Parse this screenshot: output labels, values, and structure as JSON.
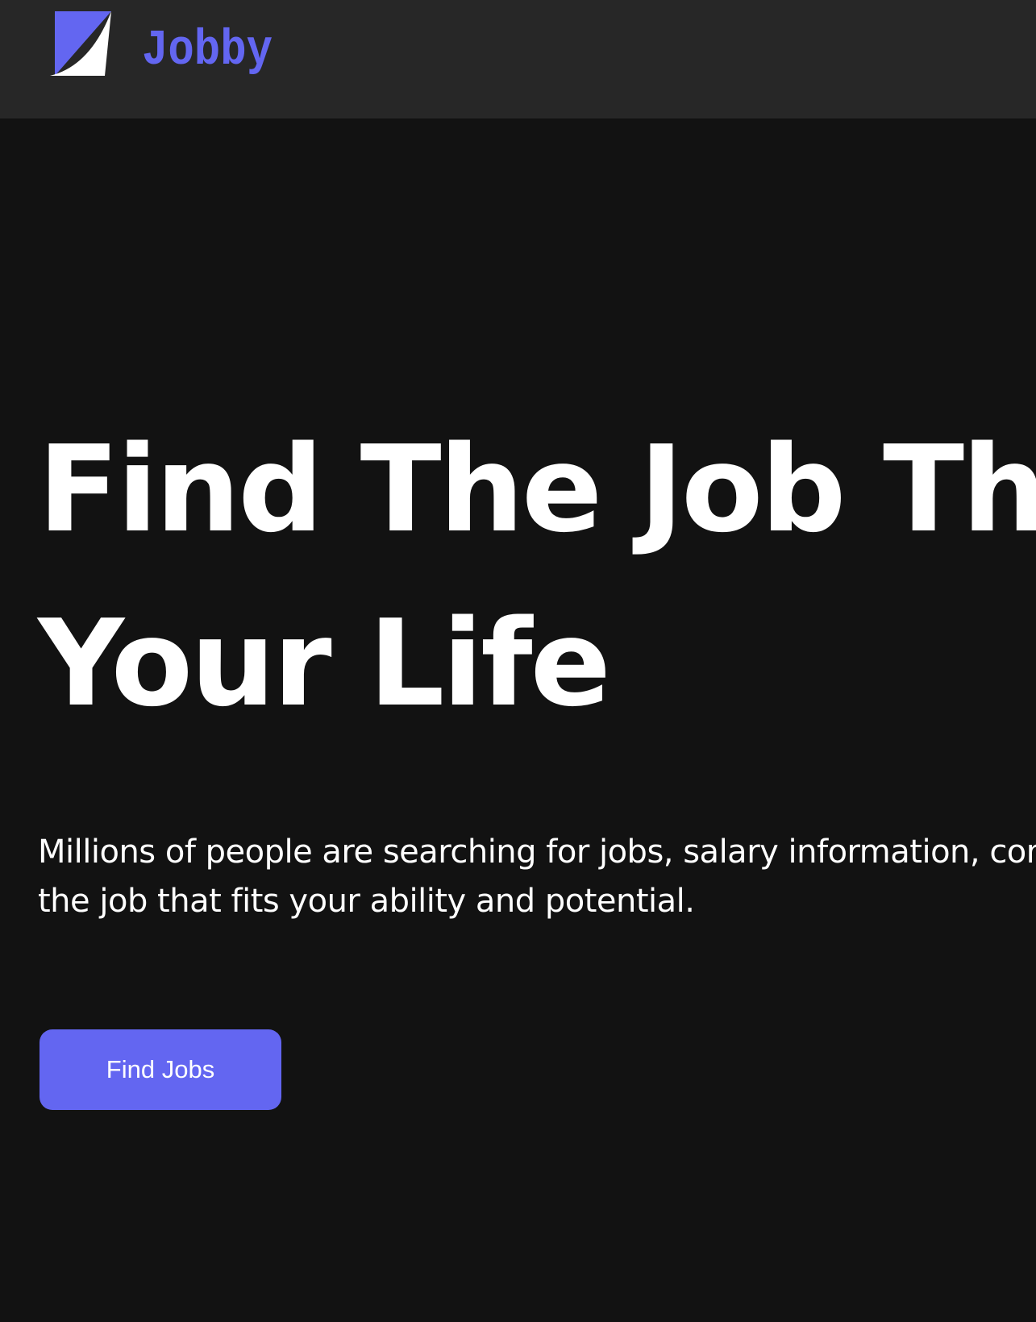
{
  "app": {
    "name": "Jobby"
  },
  "header": {
    "logo_text": "Jobby",
    "logo_icon": "jobby-logo-icon"
  },
  "hero": {
    "headline": "Find The Job That Fits Your Life",
    "description": "Millions of people are searching for jobs, salary information, company reviews. Find the job that fits your ability and potential.",
    "cta_label": "Find Jobs"
  },
  "colors": {
    "accent": "#6366f1",
    "header_background": "#272727",
    "page_background": "#121212",
    "text": "#ffffff"
  }
}
